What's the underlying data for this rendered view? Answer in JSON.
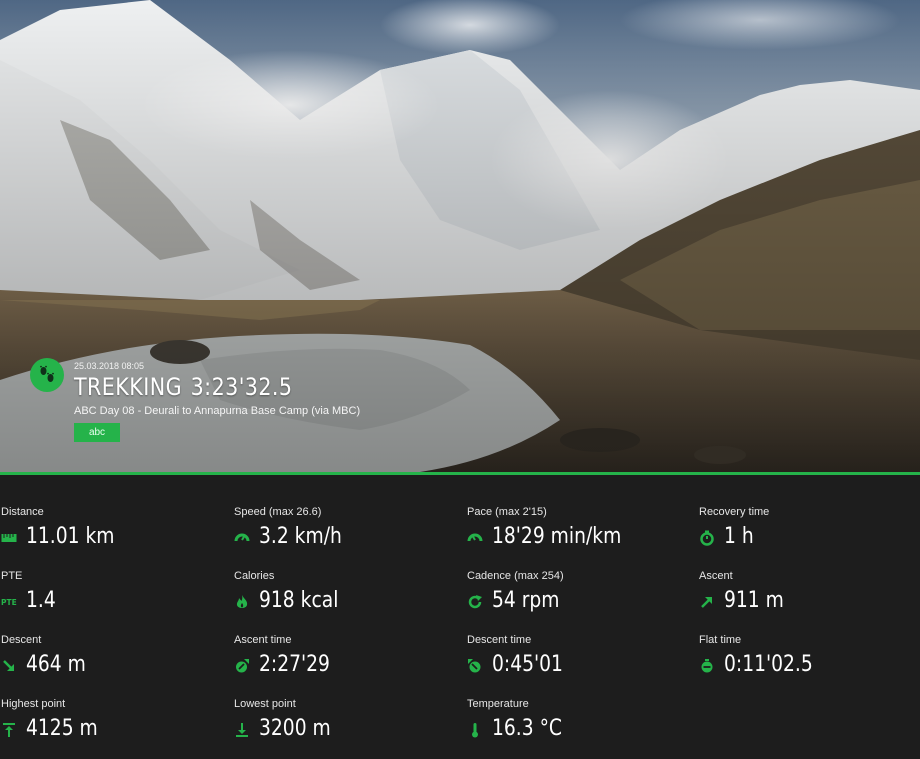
{
  "hero": {
    "date": "25.03.2018 08:05",
    "activity": "TREKKING",
    "duration": "3:23'32.5",
    "subtitle": "ABC Day 08 - Deurali to Annapurna Base Camp (via MBC)",
    "tag": "abc",
    "accent": "#25b34a",
    "badge_icon": "footprints-icon"
  },
  "stats": [
    {
      "key": "distance",
      "label": "Distance",
      "value": "11.01 km",
      "icon": "ruler-icon"
    },
    {
      "key": "speed",
      "label": "Speed",
      "max_label": "(max  26.6)",
      "value": "3.2 km/h",
      "icon": "speedometer-icon"
    },
    {
      "key": "pace",
      "label": "Pace",
      "max_label": "(max  2'15)",
      "value": "18'29 min/km",
      "icon": "speedometer-icon"
    },
    {
      "key": "recovery",
      "label": "Recovery time",
      "value": "1 h",
      "icon": "stopwatch-icon"
    },
    {
      "key": "pte",
      "label": "PTE",
      "value": "1.4",
      "icon": "pte-icon"
    },
    {
      "key": "calories",
      "label": "Calories",
      "value": "918 kcal",
      "icon": "flame-icon"
    },
    {
      "key": "cadence",
      "label": "Cadence",
      "max_label": "(max  254)",
      "value": "54 rpm",
      "icon": "cycle-arrow-icon"
    },
    {
      "key": "ascent",
      "label": "Ascent",
      "value": "911 m",
      "icon": "arrow-up-right-icon"
    },
    {
      "key": "descent",
      "label": "Descent",
      "value": "464 m",
      "icon": "arrow-down-right-icon"
    },
    {
      "key": "ascent_time",
      "label": "Ascent time",
      "value": "2:27'29",
      "icon": "clock-up-icon"
    },
    {
      "key": "descent_time",
      "label": "Descent time",
      "value": "0:45'01",
      "icon": "clock-down-icon"
    },
    {
      "key": "flat_time",
      "label": "Flat time",
      "value": "0:11'02.5",
      "icon": "clock-flat-icon"
    },
    {
      "key": "highest",
      "label": "Highest point",
      "value": "4125 m",
      "icon": "arrow-to-top-icon"
    },
    {
      "key": "lowest",
      "label": "Lowest point",
      "value": "3200 m",
      "icon": "arrow-to-bottom-icon"
    },
    {
      "key": "temperature",
      "label": "Temperature",
      "value": "16.3 °C",
      "icon": "thermometer-icon"
    }
  ]
}
